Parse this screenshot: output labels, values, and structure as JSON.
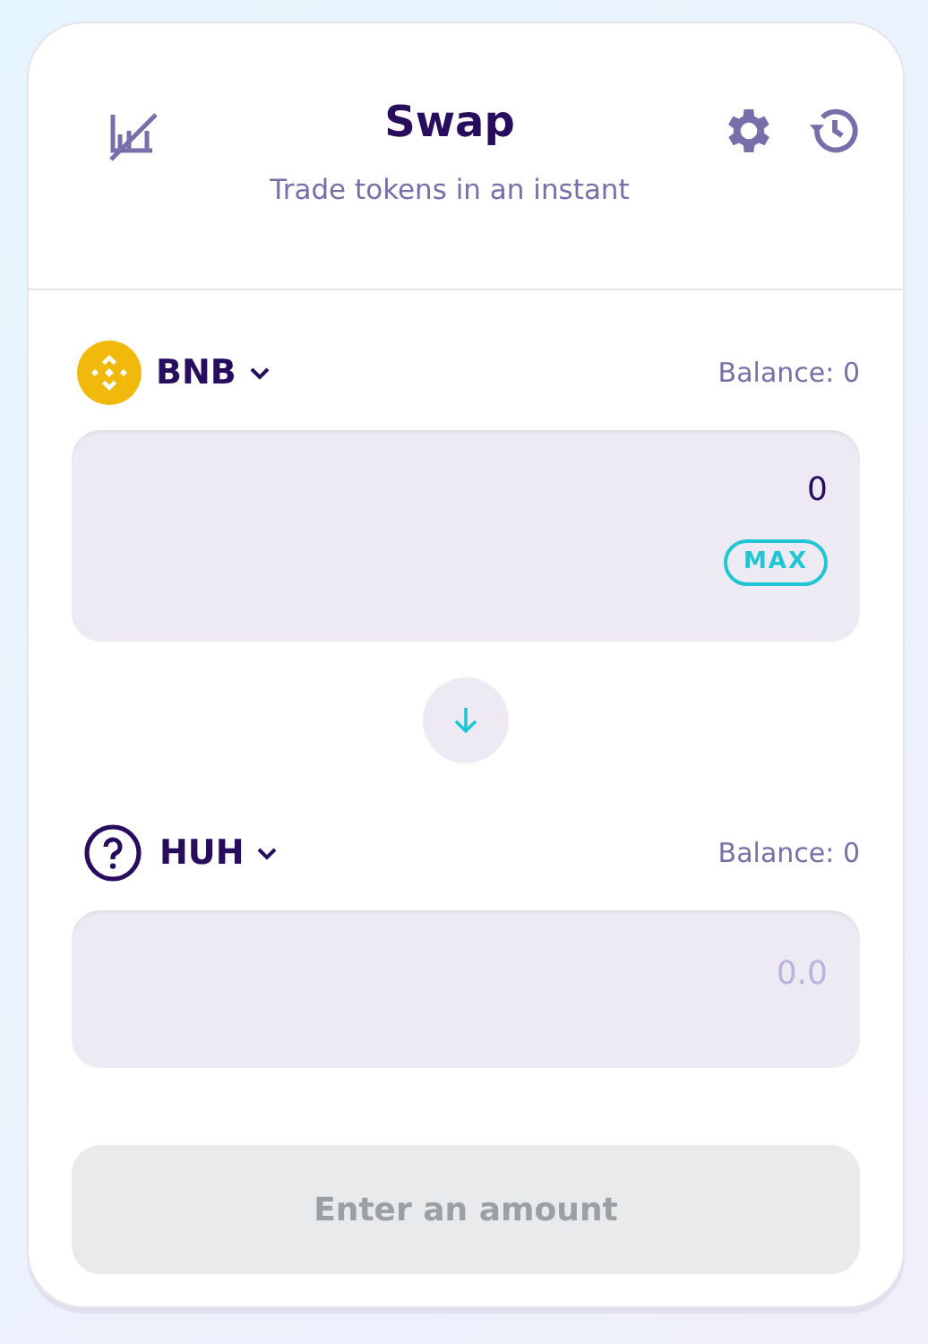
{
  "header": {
    "title": "Swap",
    "subtitle": "Trade tokens in an instant"
  },
  "inputs": [
    {
      "token": {
        "symbol": "BNB",
        "kind": "bnb"
      },
      "balance": "Balance: 0",
      "value": "0",
      "max_button": "MAX"
    },
    {
      "token": {
        "symbol": "HUH",
        "kind": "unknown"
      },
      "balance": "Balance: 0",
      "placeholder": "0.0"
    }
  ],
  "submit": {
    "label": "Enter an amount",
    "disabled": true
  }
}
